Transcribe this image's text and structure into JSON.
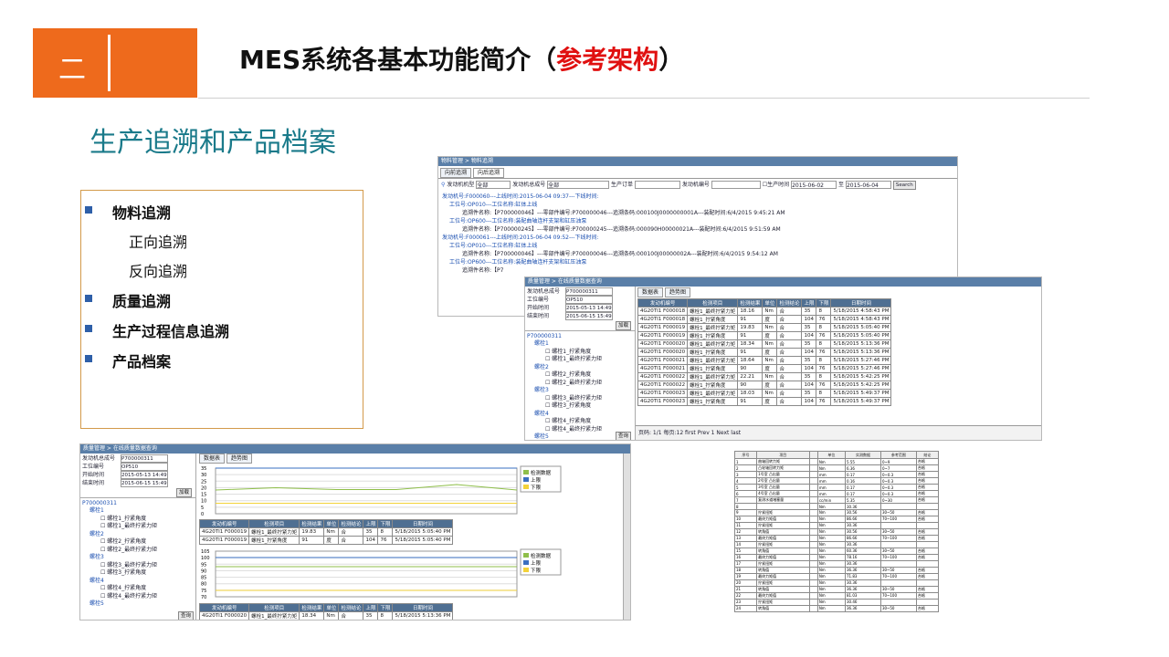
{
  "header": {
    "number": "二",
    "title_main": "MES系统各基本功能简介（",
    "title_red": "参考架构",
    "title_end": "）"
  },
  "section_title": "生产追溯和产品档案",
  "list_items": [
    {
      "label": "物料追溯",
      "bold": true,
      "bullet": true
    },
    {
      "label": "正向追溯",
      "bold": false,
      "bullet": false
    },
    {
      "label": "反向追溯",
      "bold": false,
      "bullet": false
    },
    {
      "label": "质量追溯",
      "bold": true,
      "bullet": true
    },
    {
      "label": "生产过程信息追溯",
      "bold": true,
      "bullet": true
    },
    {
      "label": "产品档案",
      "bold": true,
      "bullet": true
    }
  ],
  "panel1": {
    "header": "物料管理 > 物料追溯",
    "tabs": [
      "向前追溯",
      "向后追溯"
    ],
    "filters": [
      "发动机机型",
      "全部",
      "发动机总成号",
      "全部",
      "生产订单",
      "发动机编号",
      "生产时间",
      "2015-06-02",
      "至",
      "2015-06-04",
      "Search"
    ],
    "tree": [
      "发动机号:F000060---上线时间:2015-06-04 09:37---下线时间:",
      "工位号:OP010---工位名称:缸体上线",
      "追溯件名称:【P700000046】---零部件编号:P700000046---追溯条码:000100J0000000001A---装配时间:6/4/2015 9:45:21 AM",
      "工位号:OP600---工位名称:装配曲轴连杆支架和缸压油泵",
      "追溯件名称:【P700000245】---零部件编号:P700000245---追溯条码:000090H00000021A---装配时间:6/4/2015 9:51:59 AM",
      "发动机号:F000061---上线时间:2015-06-04 09:52---下线时间:",
      "工位号:OP010---工位名称:缸体上线",
      "追溯件名称:【P700000046】---零部件编号:P700000046---追溯条码:000100J00000002A---装配时间:6/4/2015 9:54:12 AM",
      "工位号:OP600---工位名称:装配曲轴连杆支架和缸压油泵",
      "追溯件名称:【P7"
    ]
  },
  "panel2": {
    "header": "质量管理 > 在线质量数据查询",
    "form": [
      [
        "发动机总成号",
        "P700000311"
      ],
      [
        "工位编号",
        "OP510"
      ],
      [
        "开始时间",
        "2015-05-13 14:49"
      ],
      [
        "结束时间",
        "2015-06-15 15:49"
      ]
    ],
    "load": "加载",
    "tabs": [
      "数据表",
      "趋势图"
    ],
    "tree_root": "P700000311",
    "tree": [
      "螺栓1",
      "螺栓1_拧紧角度",
      "螺栓1_最终拧紧力矩",
      "螺栓2",
      "螺栓2_拧紧角度",
      "螺栓2_最终拧紧力矩",
      "螺栓3",
      "螺栓3_最终拧紧力矩",
      "螺栓3_拧紧角度",
      "螺栓4",
      "螺栓4_拧紧角度",
      "螺栓4_最终拧紧力矩",
      "螺栓5"
    ],
    "query": "查询",
    "columns": [
      "发动机编号",
      "检测项目",
      "检测结果",
      "单位",
      "检测结论",
      "上限",
      "下限",
      "日期时间"
    ],
    "rows": [
      [
        "4G20TI1 F000018",
        "螺栓1_最终拧紧力矩",
        "18.16",
        "Nm",
        "合",
        "35",
        "8",
        "5/18/2015 4:58:43 PM"
      ],
      [
        "4G20TI1 F000018",
        "螺栓1_拧紧角度",
        "91",
        "度",
        "合",
        "104",
        "76",
        "5/18/2015 4:58:43 PM"
      ],
      [
        "4G20TI1 F000019",
        "螺栓1_最终拧紧力矩",
        "19.83",
        "Nm",
        "合",
        "35",
        "8",
        "5/18/2015 5:05:40 PM"
      ],
      [
        "4G20TI1 F000019",
        "螺栓1_拧紧角度",
        "91",
        "度",
        "合",
        "104",
        "76",
        "5/18/2015 5:05:40 PM"
      ],
      [
        "4G20TI1 F000020",
        "螺栓1_最终拧紧力矩",
        "18.34",
        "Nm",
        "合",
        "35",
        "8",
        "5/18/2015 5:13:36 PM"
      ],
      [
        "4G20TI1 F000020",
        "螺栓1_拧紧角度",
        "91",
        "度",
        "合",
        "104",
        "76",
        "5/18/2015 5:13:36 PM"
      ],
      [
        "4G20TI1 F000021",
        "螺栓1_最终拧紧力矩",
        "18.64",
        "Nm",
        "合",
        "35",
        "8",
        "5/18/2015 5:27:46 PM"
      ],
      [
        "4G20TI1 F000021",
        "螺栓1_拧紧角度",
        "90",
        "度",
        "合",
        "104",
        "76",
        "5/18/2015 5:27:46 PM"
      ],
      [
        "4G20TI1 F000022",
        "螺栓1_最终拧紧力矩",
        "22.21",
        "Nm",
        "合",
        "35",
        "8",
        "5/18/2015 5:42:25 PM"
      ],
      [
        "4G20TI1 F000022",
        "螺栓1_拧紧角度",
        "90",
        "度",
        "合",
        "104",
        "76",
        "5/18/2015 5:42:25 PM"
      ],
      [
        "4G20TI1 F000023",
        "螺栓1_最终拧紧力矩",
        "18.03",
        "Nm",
        "合",
        "35",
        "8",
        "5/18/2015 5:49:37 PM"
      ],
      [
        "4G20TI1 F000023",
        "螺栓1_拧紧角度",
        "91",
        "度",
        "合",
        "104",
        "76",
        "5/18/2015 5:49:37 PM"
      ]
    ],
    "pager": "页码: 1/1 每页:12 first Prev 1 Next last"
  },
  "panel3": {
    "header": "质量管理 > 在线质量数据查询",
    "form": [
      [
        "发动机总成号",
        "P700000311"
      ],
      [
        "工位编号",
        "OP510"
      ],
      [
        "开始时间",
        "2015-05-13 14:49"
      ],
      [
        "结束时间",
        "2015-06-15 15:49"
      ]
    ],
    "load": "加载",
    "tabs": [
      "数据表",
      "趋势图"
    ],
    "tree_root": "P700000311",
    "tree": [
      "螺栓1",
      "螺栓1_拧紧角度",
      "螺栓1_最终拧紧力矩",
      "螺栓2",
      "螺栓2_拧紧角度",
      "螺栓2_最终拧紧力矩",
      "螺栓3",
      "螺栓3_最终拧紧力矩",
      "螺栓3_拧紧角度",
      "螺栓4",
      "螺栓4_拧紧角度",
      "螺栓4_最终拧紧力矩",
      "螺栓5"
    ],
    "query": "查询",
    "legend": [
      "检测数据",
      "上限",
      "下限"
    ],
    "legend_colors": [
      "#8fbf4a",
      "#3a6fc0",
      "#f2d23a"
    ],
    "chart1_yticks": [
      "35",
      "30",
      "25",
      "20",
      "15",
      "10",
      "5",
      "0"
    ],
    "chart2_yticks": [
      "105",
      "100",
      "95",
      "90",
      "85",
      "80",
      "75",
      "70"
    ],
    "columns": [
      "发动机编号",
      "检测项目",
      "检测结果",
      "单位",
      "检测结论",
      "上限",
      "下限",
      "日期时间"
    ],
    "rows1": [
      [
        "4G20TI1 F000019",
        "螺栓1_最终拧紧力矩",
        "19.83",
        "Nm",
        "合",
        "35",
        "8",
        "5/18/2015 5:05:40 PM"
      ],
      [
        "4G20TI1 F000019",
        "螺栓1_拧紧角度",
        "91",
        "度",
        "合",
        "104",
        "76",
        "5/18/2015 5:05:40 PM"
      ]
    ],
    "rows2": [
      [
        "4G20TI1 F000020",
        "螺栓1_最终拧紧力矩",
        "18.34",
        "Nm",
        "合",
        "35",
        "8",
        "5/18/2015 5:13:36 PM"
      ]
    ]
  },
  "panel4": {
    "columns": [
      "序号",
      "项目",
      "",
      "单位",
      "实测数据",
      "参考范围",
      "结论"
    ],
    "rows": [
      [
        "1",
        "曲轴回转力矩",
        "",
        "Nm",
        "5.55",
        "0~9",
        "合格"
      ],
      [
        "2",
        "凸轮轴回转力矩",
        "",
        "Nm",
        "6.36",
        "0~7",
        "合格"
      ],
      [
        "3",
        "1号室 凸出量",
        "",
        "mm",
        "0.17",
        "0~0.3",
        "合格"
      ],
      [
        "4",
        "2号室 凸出量",
        "",
        "mm",
        "0.16",
        "0~0.3",
        "合格"
      ],
      [
        "5",
        "3号室 凸出量",
        "",
        "mm",
        "0.17",
        "0~0.3",
        "合格"
      ],
      [
        "6",
        "4号室 凸出量",
        "",
        "mm",
        "0.17",
        "0~0.3",
        "合格"
      ],
      [
        "7",
        "复测水道堵塞量",
        "",
        "cc/min",
        "5.35",
        "0~30",
        "合格"
      ],
      [
        "8",
        "",
        "",
        "Nm",
        "30.36",
        "",
        ""
      ],
      [
        "9",
        "拧紧扭矩",
        "",
        "Nm",
        "30.56",
        "30~50",
        "合格"
      ],
      [
        "10",
        "最终力矩值",
        "",
        "Nm",
        "86.66",
        "70~100",
        "合格"
      ],
      [
        "11",
        "拧紧扭矩",
        "",
        "Nm",
        "30.36",
        "",
        ""
      ],
      [
        "12",
        "转角值",
        "",
        "Nm",
        "30.56",
        "30~50",
        "合格"
      ],
      [
        "13",
        "最终力矩值",
        "",
        "Nm",
        "86.66",
        "70~100",
        "合格"
      ],
      [
        "14",
        "拧紧扭矩",
        "",
        "Nm",
        "30.36",
        "",
        ""
      ],
      [
        "15",
        "转角值",
        "",
        "Nm",
        "60.36",
        "30~50",
        "合格"
      ],
      [
        "16",
        "最终力矩值",
        "",
        "Nm",
        "78.16",
        "70~100",
        "合格"
      ],
      [
        "17",
        "拧紧扭矩",
        "",
        "Nm",
        "30.36",
        "",
        ""
      ],
      [
        "18",
        "转角值",
        "",
        "Nm",
        "36.36",
        "30~50",
        "合格"
      ],
      [
        "19",
        "最终力矩值",
        "",
        "Nm",
        "71.83",
        "70~100",
        "合格"
      ],
      [
        "20",
        "拧紧扭矩",
        "",
        "Nm",
        "30.36",
        "",
        ""
      ],
      [
        "21",
        "转角值",
        "",
        "Nm",
        "36.36",
        "30~50",
        "合格"
      ],
      [
        "22",
        "最终力矩值",
        "",
        "Nm",
        "81.03",
        "70~100",
        "合格"
      ],
      [
        "23",
        "拧紧扭矩",
        "",
        "Nm",
        "30.46",
        "",
        ""
      ],
      [
        "24",
        "转角值",
        "",
        "Nm",
        "36.36",
        "30~50",
        "合格"
      ]
    ]
  }
}
